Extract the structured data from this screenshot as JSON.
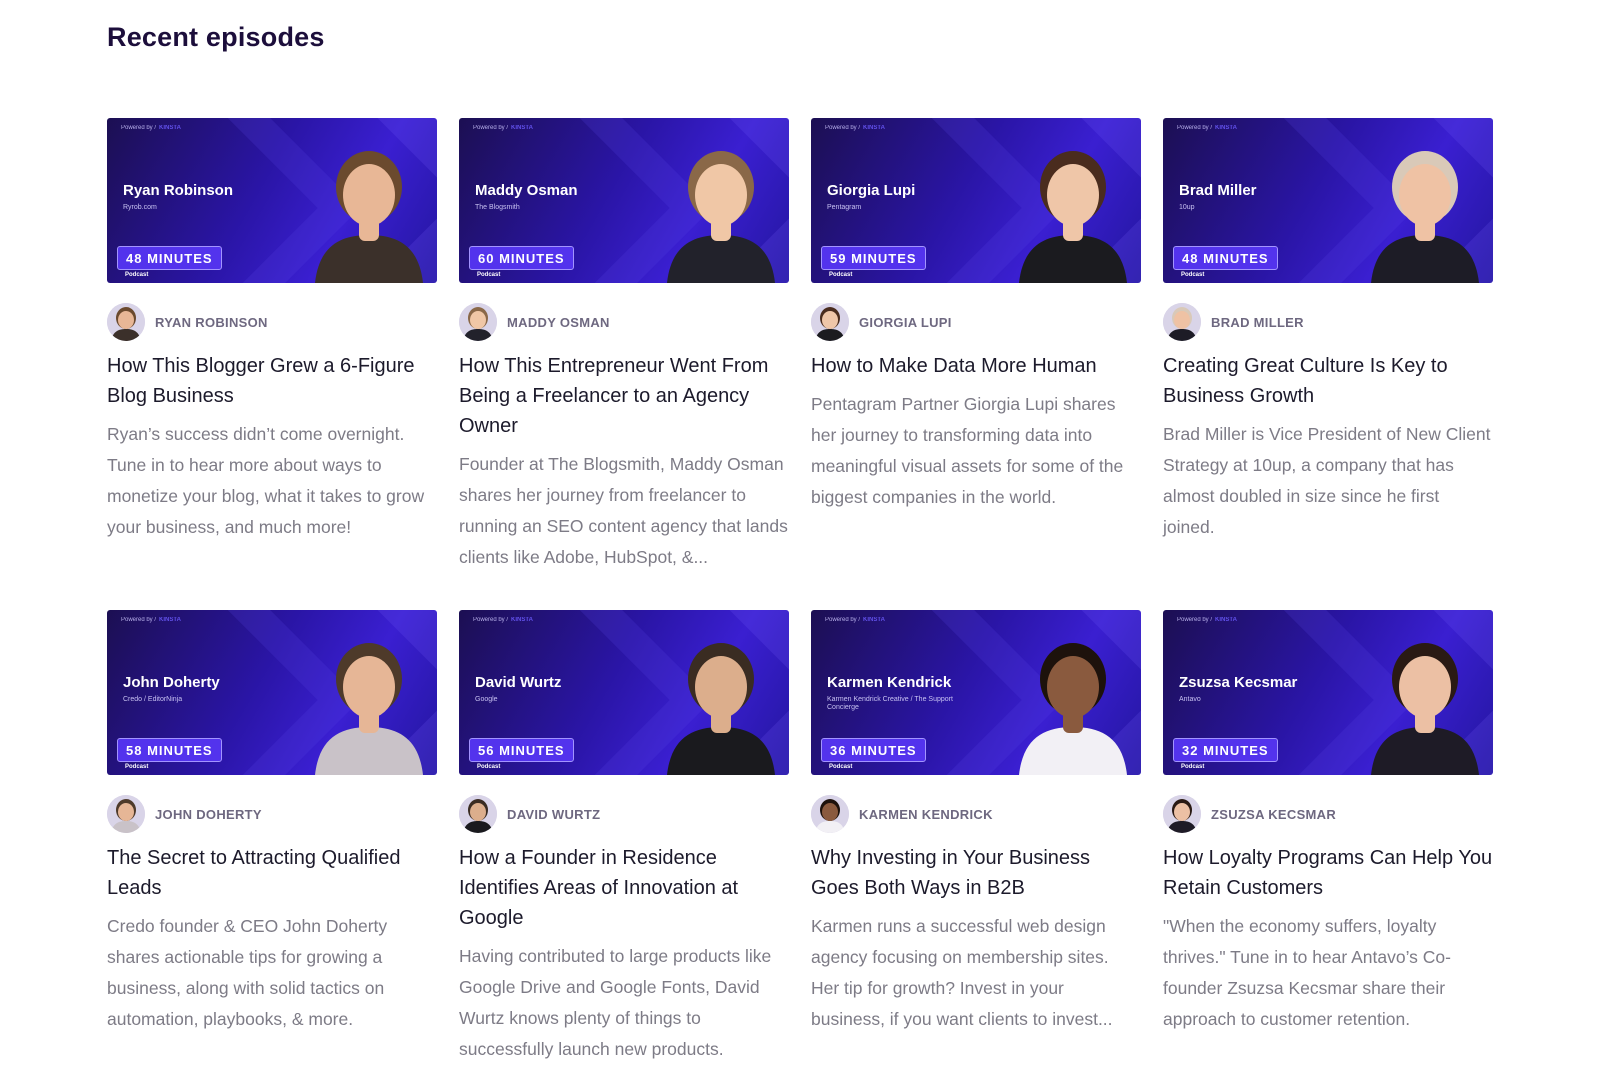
{
  "section": {
    "title": "Recent episodes"
  },
  "thumb_common": {
    "powered_by": "Powered by /",
    "brand": "KINSTA",
    "tag": "Podcast"
  },
  "episodes": [
    {
      "name": "Ryan Robinson",
      "org": "Ryrob.com",
      "minutes": "48 MINUTES",
      "author": "RYAN ROBINSON",
      "title": "How This Blogger Grew a 6-Figure Blog Business",
      "description": "Ryan’s success didn’t come overnight. Tune in to hear more about ways to monetize your blog, what it takes to grow your business, and much more!",
      "hair": "#6b4a2e",
      "skin": "#e8b796",
      "shirt": "#3b302a"
    },
    {
      "name": "Maddy Osman",
      "org": "The Blogsmith",
      "minutes": "60 MINUTES",
      "author": "MADDY OSMAN",
      "title": "How This Entrepreneur Went From Being a Freelancer to an Agency Owner",
      "description": "Founder at The Blogsmith, Maddy Osman shares her journey from freelancer to running an SEO content agency that lands clients like Adobe, HubSpot, &...",
      "hair": "#8a6848",
      "skin": "#f0c7a6",
      "shirt": "#22222b"
    },
    {
      "name": "Giorgia Lupi",
      "org": "Pentagram",
      "minutes": "59 MINUTES",
      "author": "GIORGIA LUPI",
      "title": "How to Make Data More Human",
      "description": "Pentagram Partner Giorgia Lupi shares her journey to transforming data into meaningful visual assets for some of the biggest companies in the world.",
      "hair": "#4a2c1e",
      "skin": "#efc6a8",
      "shirt": "#1b1b1f"
    },
    {
      "name": "Brad Miller",
      "org": "10up",
      "minutes": "48 MINUTES",
      "author": "BRAD MILLER",
      "title": "Creating Great Culture Is Key to Business Growth",
      "description": "Brad Miller is Vice President of New Client Strategy at 10up, a company that has almost doubled in size since he first joined.",
      "hair": "#d9c9b8",
      "skin": "#efc2a4",
      "shirt": "#1d1c26"
    },
    {
      "name": "John Doherty",
      "org": "Credo / EditorNinja",
      "minutes": "58 MINUTES",
      "author": "JOHN DOHERTY",
      "title": "The Secret to Attracting Qualified Leads",
      "description": "Credo founder & CEO John Doherty shares actionable tips for growing a business, along with solid tactics on automation, playbooks, & more.",
      "hair": "#4e3a2a",
      "skin": "#e6b696",
      "shirt": "#c9c2c8"
    },
    {
      "name": "David Wurtz",
      "org": "Google",
      "minutes": "56 MINUTES",
      "author": "DAVID WURTZ",
      "title": "How a Founder in Residence Identifies Areas of Innovation at Google",
      "description": "Having contributed to large products like Google Drive and Google Fonts, David Wurtz knows plenty of things to successfully launch new products.",
      "hair": "#3a2c22",
      "skin": "#dcae8c",
      "shirt": "#1a1a1e"
    },
    {
      "name": "Karmen Kendrick",
      "org": "Karmen Kendrick Creative / The Support Concierge",
      "minutes": "36 MINUTES",
      "author": "KARMEN KENDRICK",
      "title": "Why Investing in Your Business Goes Both Ways in B2B",
      "description": "Karmen runs a successful web design agency focusing on membership sites. Her tip for growth? Invest in your business, if you want clients to invest...",
      "hair": "#1d120c",
      "skin": "#8a5a3e",
      "shirt": "#f2f0f5"
    },
    {
      "name": "Zsuzsa Kecsmar",
      "org": "Antavo",
      "minutes": "32 MINUTES",
      "author": "ZSUZSA KECSMAR",
      "title": "How Loyalty Programs Can Help You Retain Customers",
      "description": "\"When the economy suffers, loyalty thrives.\" Tune in to hear Antavo’s Co-founder Zsuzsa Kecsmar share their approach to customer retention.",
      "hair": "#2a1a14",
      "skin": "#ecc0a4",
      "shirt": "#1e1b26"
    }
  ]
}
